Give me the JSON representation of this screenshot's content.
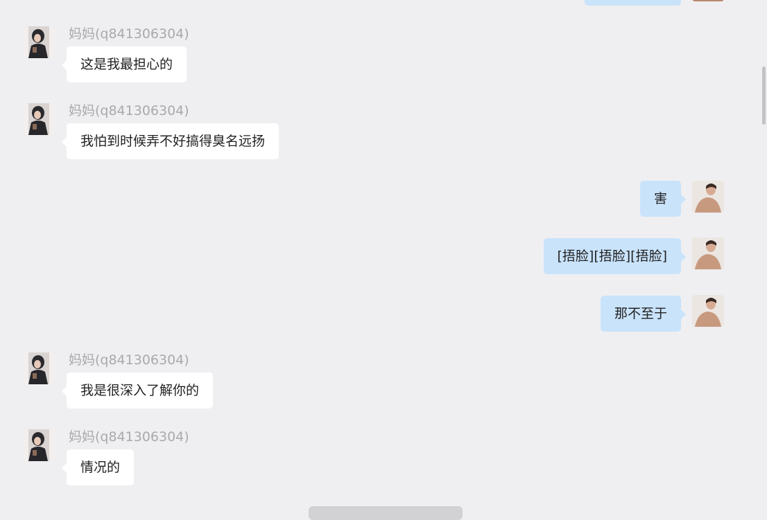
{
  "chat": {
    "contact_name": "妈妈(q841306304)",
    "messages": [
      {
        "direction": "in",
        "sender": "妈妈(q841306304)",
        "text": "这是我最担心的"
      },
      {
        "direction": "in",
        "sender": "妈妈(q841306304)",
        "text": "我怕到时候弄不好搞得臭名远扬"
      },
      {
        "direction": "out",
        "text": "害"
      },
      {
        "direction": "out",
        "text": "[捂脸][捂脸][捂脸]"
      },
      {
        "direction": "out",
        "text": "那不至于"
      },
      {
        "direction": "in",
        "sender": "妈妈(q841306304)",
        "text": "我是很深入了解你的"
      },
      {
        "direction": "in",
        "sender": "妈妈(q841306304)",
        "text": "情况的"
      }
    ]
  },
  "colors": {
    "background": "#efeff1",
    "incoming_bubble": "#ffffff",
    "outgoing_bubble": "#c9e3fb",
    "sender_name": "#a9a9ad"
  },
  "icons": {
    "incoming_avatar": "mom-avatar-icon",
    "outgoing_avatar": "user-avatar-icon"
  }
}
